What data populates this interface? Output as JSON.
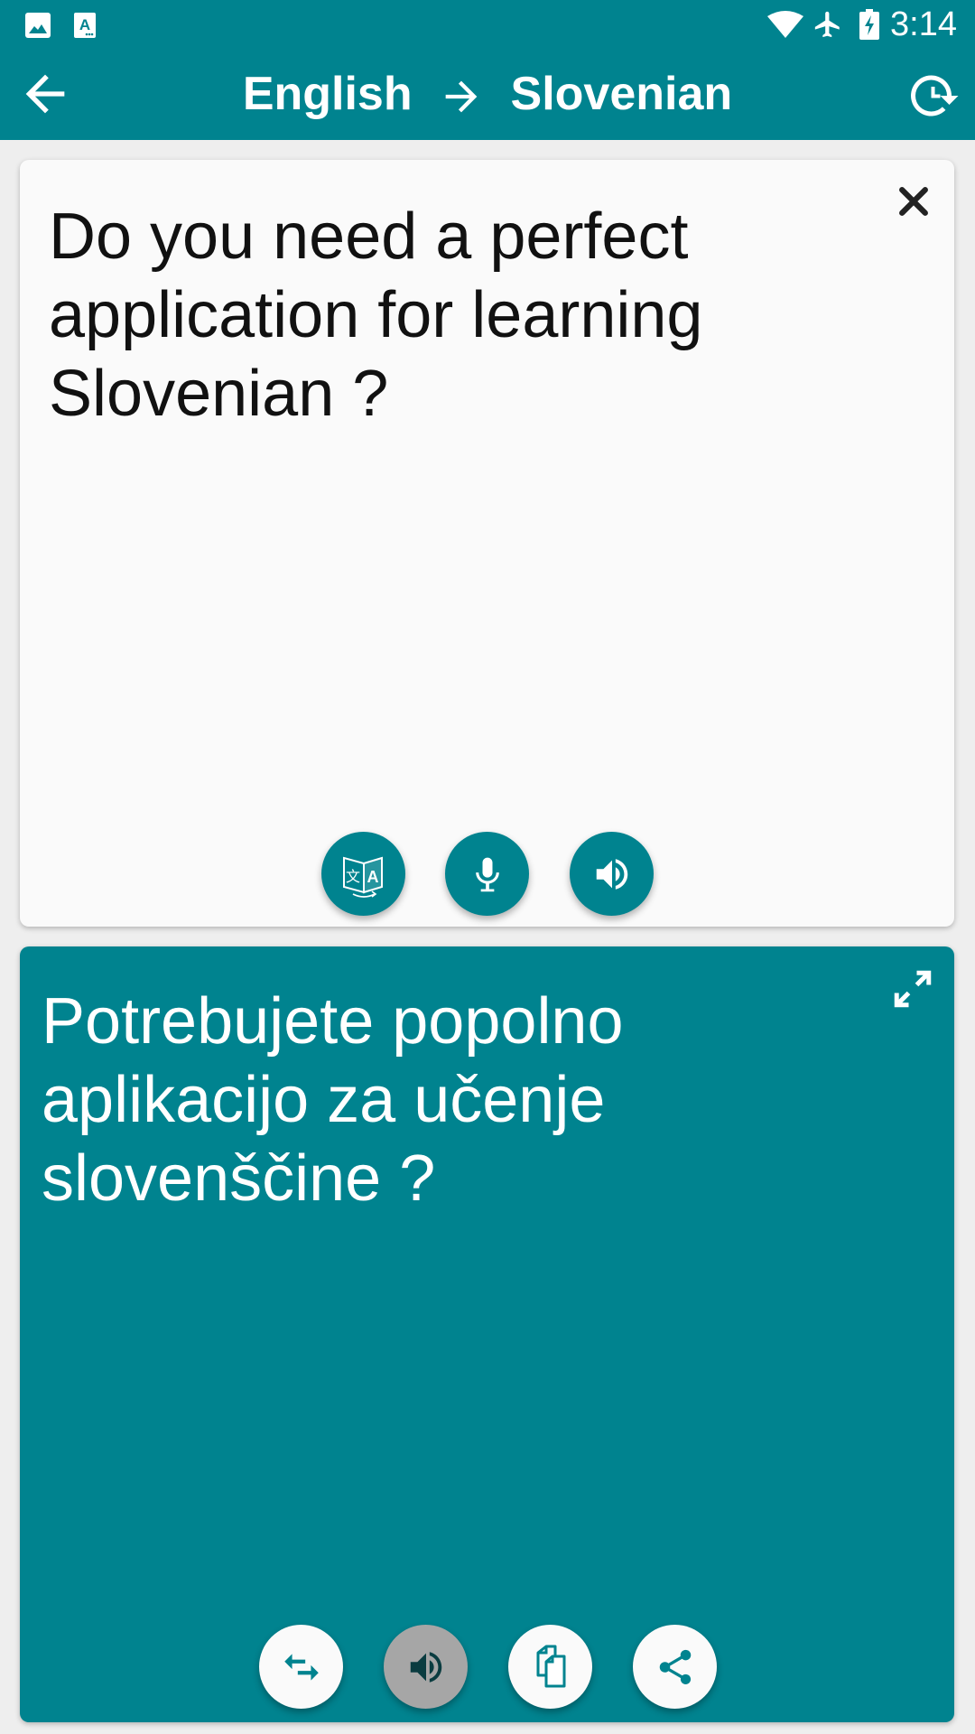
{
  "status_bar": {
    "time": "3:14",
    "left_icons": [
      "image-notification-icon",
      "translate-app-notification-icon"
    ],
    "right_icons": [
      "wifi-icon",
      "airplane-mode-icon",
      "battery-charging-icon"
    ]
  },
  "app_bar": {
    "source_language": "English",
    "target_language": "Slovenian",
    "back_icon": "arrow-left-icon",
    "direction_icon": "arrow-right-icon",
    "history_icon": "history-icon"
  },
  "source_panel": {
    "text": "Do you need a perfect application for learning Slovenian ?",
    "close_icon": "close-icon",
    "buttons": [
      {
        "name": "translate-button",
        "icon": "translate-icon"
      },
      {
        "name": "microphone-button",
        "icon": "microphone-icon"
      },
      {
        "name": "speak-source-button",
        "icon": "speaker-icon"
      }
    ]
  },
  "target_panel": {
    "text": "Potrebujete popolno aplikacijo za učenje slovenščine ?",
    "expand_icon": "fullscreen-expand-icon",
    "buttons": [
      {
        "name": "swap-languages-button",
        "icon": "swap-icon"
      },
      {
        "name": "speak-target-button",
        "icon": "speaker-icon",
        "state": "disabled"
      },
      {
        "name": "copy-button",
        "icon": "copy-icon"
      },
      {
        "name": "share-button",
        "icon": "share-icon"
      }
    ]
  },
  "colors": {
    "primary": "#00838f",
    "background": "#eeeeee",
    "card": "#fafafa",
    "disabled_button": "#a6a6a6"
  }
}
